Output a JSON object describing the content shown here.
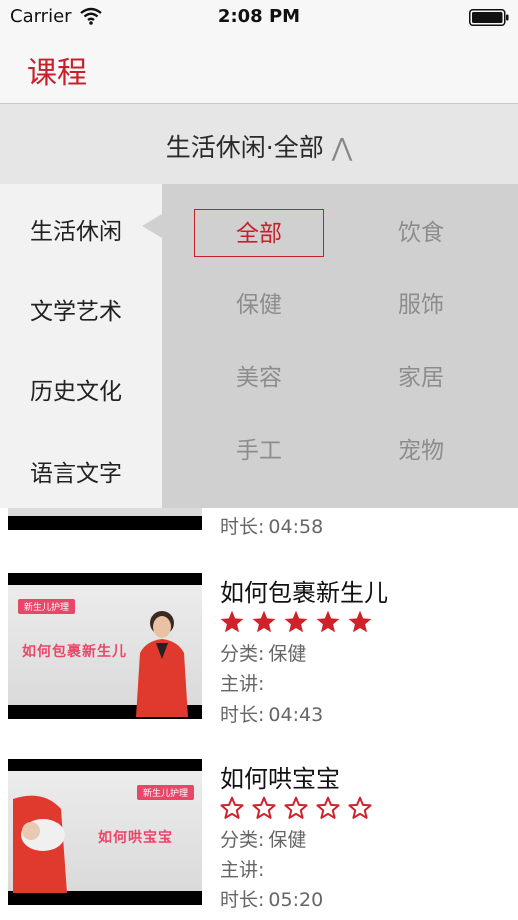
{
  "status_bar": {
    "carrier": "Carrier",
    "time": "2:08 PM"
  },
  "nav": {
    "title": "课程"
  },
  "filter": {
    "title": "生活休闲·全部",
    "caret": "⋀"
  },
  "categories": [
    "生活休闲",
    "文学艺术",
    "历史文化",
    "语言文字"
  ],
  "subcategories": [
    "全部",
    "饮食",
    "保健",
    "服饰",
    "美容",
    "家居",
    "手工",
    "宠物"
  ],
  "selected_subcategory": "全部",
  "labels": {
    "category": "分类:",
    "lecturer": "主讲:",
    "duration": "时长:"
  },
  "courses": [
    {
      "duration": "04:58"
    },
    {
      "title": "如何包裹新生儿",
      "rating": 5,
      "category": "保健",
      "lecturer": "",
      "duration": "04:43",
      "thumb_tag": "新生儿护理",
      "thumb_text": "如何包裹新生儿"
    },
    {
      "title": "如何哄宝宝",
      "rating": 0,
      "category": "保健",
      "lecturer": "",
      "duration": "05:20",
      "thumb_tag": "新生儿护理",
      "thumb_text": "如何哄宝宝"
    }
  ],
  "colors": {
    "accent": "#c8202b",
    "star": "#d0202a"
  },
  "icons": {
    "wifi": "wifi-icon",
    "battery": "battery-icon",
    "star_filled": "star-filled-icon",
    "star_empty": "star-empty-icon"
  }
}
